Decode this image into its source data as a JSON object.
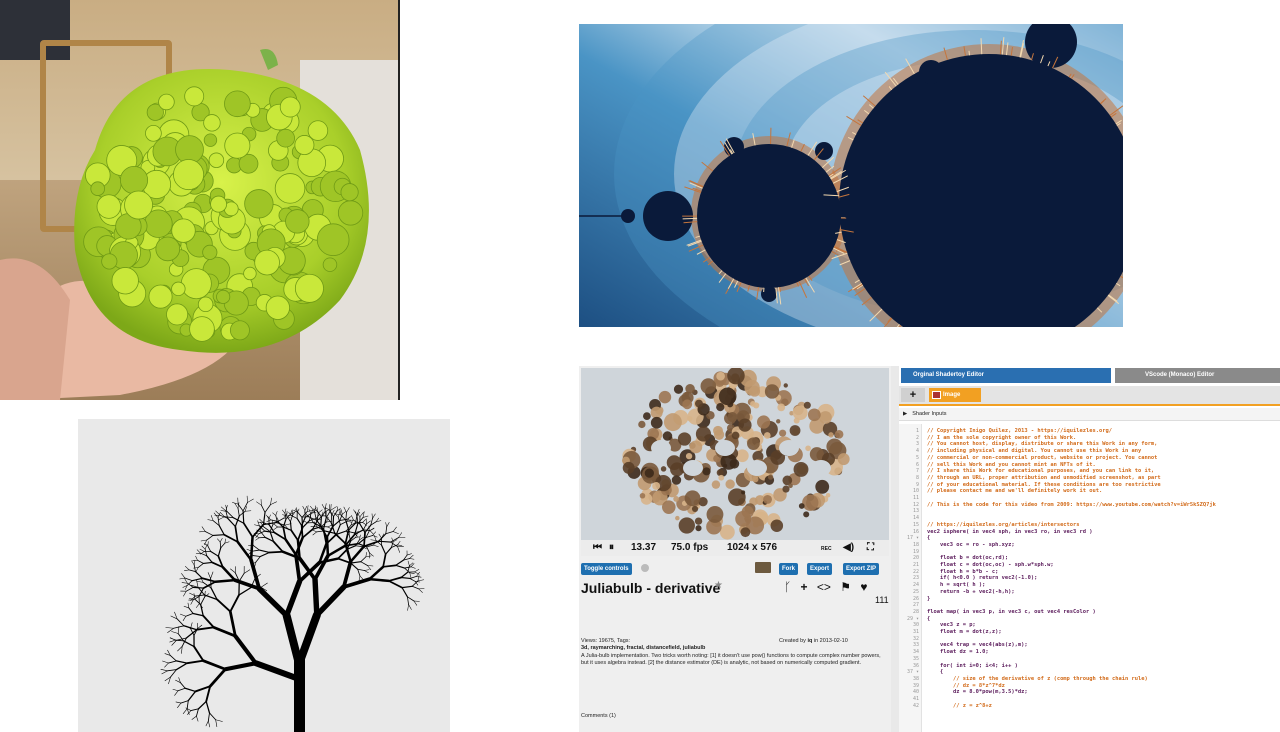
{
  "images": {
    "photo": {
      "subject": "romanesco"
    },
    "tree": {
      "subject": "fractal tree"
    },
    "mandelbrot": {
      "palette": {
        "set": "#0a1a3a",
        "light": "#eaf2f8",
        "mid": "#4a94c5",
        "dark": "#1d4f82",
        "edge": "#c4753d"
      }
    }
  },
  "shadertoy": {
    "playback": {
      "time": "13.37",
      "fps": "75.0 fps",
      "resolution": "1024 x 576",
      "rec": "REC"
    },
    "buttons": {
      "toggle": "Toggle controls",
      "fork": "Fork",
      "export": "Export",
      "export_zip": "Export ZIP"
    },
    "title": "Juliabulb - derivative",
    "likes": "111",
    "views_tags": "Views: 19675, Tags:",
    "tags": "3d, raymarching, fractal, distancefield, juliabulb",
    "created_by_prefix": "Created by ",
    "created_by": "iq",
    "created_date": " in 2013-02-10",
    "description": "A Julia-bulb implementation. Two tricks worth noting: [1] it doesn't use pow() functions to compute complex number powers, but it uses algebra instead.  [2] the distance estimator (DE) is analytic, not based on numerically computed gradient.",
    "comments": "Comments (1)",
    "editor_tabs": {
      "original": "Orginal Shadertoy Editor",
      "vscode": "VScode (Monaco) Editor"
    },
    "image_tab": "Image",
    "plus_tab": "+",
    "shader_inputs": "Shader Inputs",
    "code_lines": [
      {
        "n": "1",
        "t": "// Copyright Inigo Quilez, 2013 - https://iquilezles.org/",
        "c": "cm"
      },
      {
        "n": "2",
        "t": "// I am the sole copyright owner of this Work.",
        "c": "cm"
      },
      {
        "n": "3",
        "t": "// You cannot host, display, distribute or share this Work in any form,",
        "c": "cm"
      },
      {
        "n": "4",
        "t": "// including physical and digital. You cannot use this Work in any",
        "c": "cm"
      },
      {
        "n": "5",
        "t": "// commercial or non-commercial product, website or project. You cannot",
        "c": "cm"
      },
      {
        "n": "6",
        "t": "// sell this Work and you cannot mint an NFTs of it.",
        "c": "cm"
      },
      {
        "n": "7",
        "t": "// I share this Work for educational purposes, and you can link to it,",
        "c": "cm"
      },
      {
        "n": "8",
        "t": "// through an URL, proper attribution and unmodified screenshot, as part",
        "c": "cm"
      },
      {
        "n": "9",
        "t": "// of your educational material. If these conditions are too restrictive",
        "c": "cm"
      },
      {
        "n": "10",
        "t": "// please contact me and we'll definitely work it out.",
        "c": "cm"
      },
      {
        "n": "11",
        "t": "",
        "c": "cd"
      },
      {
        "n": "12",
        "t": "// This is the code for this video from 2009: https://www.youtube.com/watch?v=iWr5kSZQ7jk",
        "c": "cm"
      },
      {
        "n": "13",
        "t": "",
        "c": "cd"
      },
      {
        "n": "14",
        "t": "",
        "c": "cd"
      },
      {
        "n": "15",
        "t": "// https://iquilezles.org/articles/intersectors",
        "c": "cm"
      },
      {
        "n": "16",
        "t": "vec2 isphere( in vec4 sph, in vec3 ro, in vec3 rd )",
        "c": "cd"
      },
      {
        "n": "17 ▾",
        "t": "{",
        "c": "cd"
      },
      {
        "n": "18",
        "t": "    vec3 oc = ro - sph.xyz;",
        "c": "cd"
      },
      {
        "n": "19",
        "t": "",
        "c": "cd"
      },
      {
        "n": "20",
        "t": "    float b = dot(oc,rd);",
        "c": "cd"
      },
      {
        "n": "21",
        "t": "    float c = dot(oc,oc) - sph.w*sph.w;",
        "c": "cd"
      },
      {
        "n": "22",
        "t": "    float h = b*b - c;",
        "c": "cd"
      },
      {
        "n": "23",
        "t": "    if( h<0.0 ) return vec2(-1.0);",
        "c": "cd"
      },
      {
        "n": "24",
        "t": "    h = sqrt( h );",
        "c": "cd"
      },
      {
        "n": "25",
        "t": "    return -b + vec2(-h,h);",
        "c": "cd"
      },
      {
        "n": "26",
        "t": "}",
        "c": "cd"
      },
      {
        "n": "27",
        "t": "",
        "c": "cd"
      },
      {
        "n": "28",
        "t": "float map( in vec3 p, in vec3 c, out vec4 resColor )",
        "c": "cd"
      },
      {
        "n": "29 ▾",
        "t": "{",
        "c": "cd"
      },
      {
        "n": "30",
        "t": "    vec3 z = p;",
        "c": "cd"
      },
      {
        "n": "31",
        "t": "    float m = dot(z,z);",
        "c": "cd"
      },
      {
        "n": "32",
        "t": "",
        "c": "cd"
      },
      {
        "n": "33",
        "t": "    vec4 trap = vec4(abs(z),m);",
        "c": "cd"
      },
      {
        "n": "34",
        "t": "    float dz = 1.0;",
        "c": "cd"
      },
      {
        "n": "35",
        "t": "",
        "c": "cd"
      },
      {
        "n": "36",
        "t": "    for( int i=0; i<4; i++ )",
        "c": "cd"
      },
      {
        "n": "37 ▾",
        "t": "    {",
        "c": "cd"
      },
      {
        "n": "38",
        "t": "        // size of the derivative of z (comp through the chain rule)",
        "c": "cm"
      },
      {
        "n": "39",
        "t": "        // dz = 8*z^7*dz",
        "c": "cm"
      },
      {
        "n": "40",
        "t": "        dz = 8.0*pow(m,3.5)*dz;",
        "c": "cd"
      },
      {
        "n": "41",
        "t": "",
        "c": "cd"
      },
      {
        "n": "42",
        "t": "        // z = z^8+z",
        "c": "cm"
      }
    ]
  }
}
